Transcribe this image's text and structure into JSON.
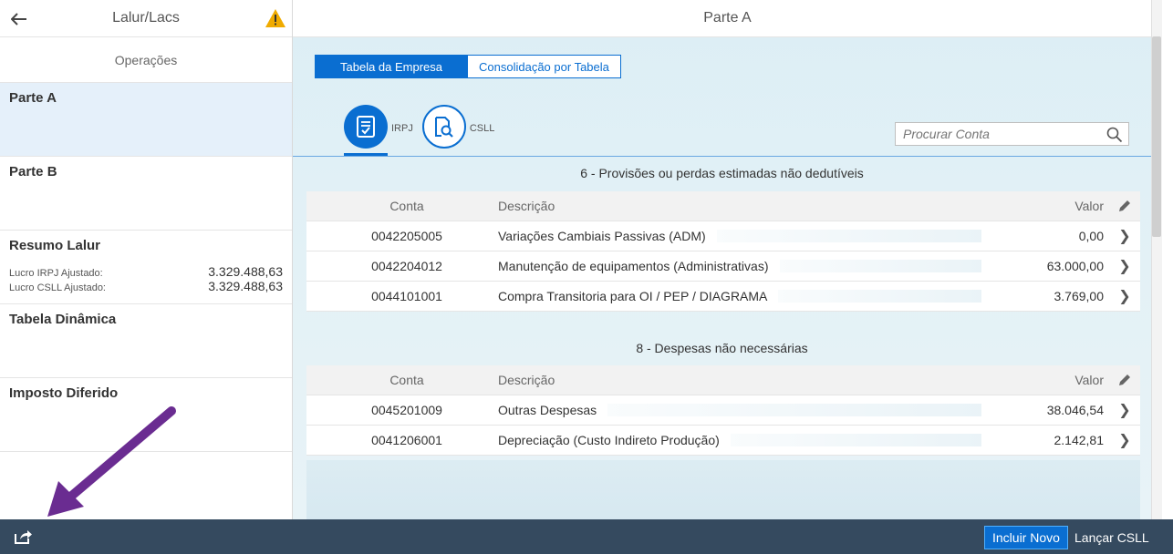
{
  "master": {
    "title": "Lalur/Lacs",
    "subheader": "Operações",
    "items": [
      {
        "title": "Parte A",
        "selected": true
      },
      {
        "title": "Parte B"
      },
      {
        "title": "Resumo Lalur",
        "kv": [
          {
            "label": "Lucro IRPJ Ajustado:",
            "value": "3.329.488,63"
          },
          {
            "label": "Lucro CSLL Ajustado:",
            "value": "3.329.488,63"
          }
        ]
      },
      {
        "title": "Tabela Dinâmica"
      },
      {
        "title": "Imposto Diferido"
      }
    ]
  },
  "detail": {
    "title": "Parte A",
    "segments": [
      {
        "label": "Tabela da Empresa",
        "active": true
      },
      {
        "label": "Consolidação por Tabela",
        "active": false
      }
    ],
    "tabs": [
      {
        "label": "IRPJ",
        "icon": "document-check-icon",
        "active": true
      },
      {
        "label": "CSLL",
        "icon": "document-search-icon",
        "active": false
      }
    ],
    "search": {
      "placeholder": "Procurar Conta"
    },
    "columns": {
      "conta": "Conta",
      "descricao": "Descrição",
      "valor": "Valor"
    },
    "groups": [
      {
        "title": "6 - Provisões ou perdas estimadas não dedutíveis",
        "rows": [
          {
            "conta": "0042205005",
            "descricao": "Variações Cambiais Passivas (ADM)",
            "valor": "0,00"
          },
          {
            "conta": "0042204012",
            "descricao": "Manutenção de equipamentos (Administrativas)",
            "valor": "63.000,00"
          },
          {
            "conta": "0044101001",
            "descricao": "Compra Transitoria para OI / PEP / DIAGRAMA",
            "valor": "3.769,00"
          }
        ]
      },
      {
        "title": "8 - Despesas não necessárias",
        "rows": [
          {
            "conta": "0045201009",
            "descricao": "Outras Despesas",
            "valor": "38.046,54"
          },
          {
            "conta": "0041206001",
            "descricao": "Depreciação (Custo Indireto Produção)",
            "valor": "2.142,81"
          }
        ]
      }
    ]
  },
  "footer": {
    "primary_label": "Incluir Novo",
    "secondary_label": "Lançar CSLL"
  },
  "colors": {
    "accent": "#0a6ed1",
    "footer": "#354a5f",
    "annotation_arrow": "#6a2c91",
    "warning": "#f0ab00"
  }
}
